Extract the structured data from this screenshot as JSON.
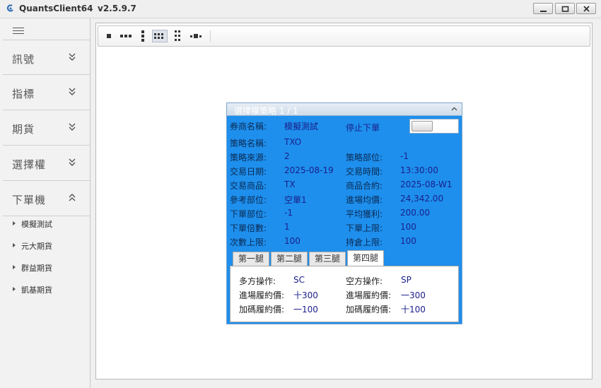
{
  "window": {
    "title": "QuantsClient64",
    "version": "v2.5.9.7",
    "minimize_icon": "minimize-icon",
    "maximize_icon": "maximize-icon",
    "close_icon": "close-icon"
  },
  "sidebar": {
    "menu_icon": "hamburger-icon",
    "sections": [
      {
        "label": "訊號",
        "state": "collapsed"
      },
      {
        "label": "指標",
        "state": "collapsed"
      },
      {
        "label": "期貨",
        "state": "collapsed"
      },
      {
        "label": "選擇權",
        "state": "collapsed"
      },
      {
        "label": "下單機",
        "state": "expanded"
      }
    ],
    "order_items": [
      "模擬測試",
      "元大期貨",
      "群益期貨",
      "凱基期貨"
    ]
  },
  "toolbar": {
    "buttons": [
      "layout-1-icon",
      "layout-3-row-icon",
      "layout-3-col-icon",
      "layout-grid-icon",
      "layout-grid-col-icon",
      "layout-mixed-icon"
    ],
    "active_index": 3
  },
  "strategy_panel": {
    "title": "選擇權策略 1 / 1",
    "accent_color": "#1e8fed",
    "broker_label": "券商名稱:",
    "broker_value": "模擬測試",
    "stop_order_label": "停止下單",
    "stop_order_on": false,
    "left_fields": [
      {
        "label": "策略名稱:",
        "value": "TXO"
      },
      {
        "label": "策略來源:",
        "value": "2"
      },
      {
        "label": "交易日期:",
        "value": "2025-08-19"
      },
      {
        "label": "交易商品:",
        "value": "TX"
      },
      {
        "label": "參考部位:",
        "value": "空單1"
      },
      {
        "label": "下單部位:",
        "value": "-1"
      },
      {
        "label": "下單倍數:",
        "value": "1"
      },
      {
        "label": "次數上限:",
        "value": "100"
      }
    ],
    "right_fields": [
      {
        "label": "策略部位:",
        "value": "-1"
      },
      {
        "label": "交易時間:",
        "value": "13:30:00"
      },
      {
        "label": "商品合約:",
        "value": "2025-08-W1"
      },
      {
        "label": "進場均價:",
        "value": "24,342.00"
      },
      {
        "label": "平均獲利:",
        "value": "200.00"
      },
      {
        "label": "下單上限:",
        "value": "100"
      },
      {
        "label": "持倉上限:",
        "value": "100"
      }
    ],
    "tabs": [
      "第一腿",
      "第二腿",
      "第三腿",
      "第四腿"
    ],
    "selected_tab": 3,
    "leg": {
      "long_op_label": "多方操作:",
      "long_op_value": "SC",
      "short_op_label": "空方操作:",
      "short_op_value": "SP",
      "entry_strike_label": "進場履約價:",
      "entry_strike_long": "十300",
      "entry_strike_short": "一300",
      "add_strike_label": "加碼履約價:",
      "add_strike_long": "一100",
      "add_strike_short": "十100"
    }
  }
}
